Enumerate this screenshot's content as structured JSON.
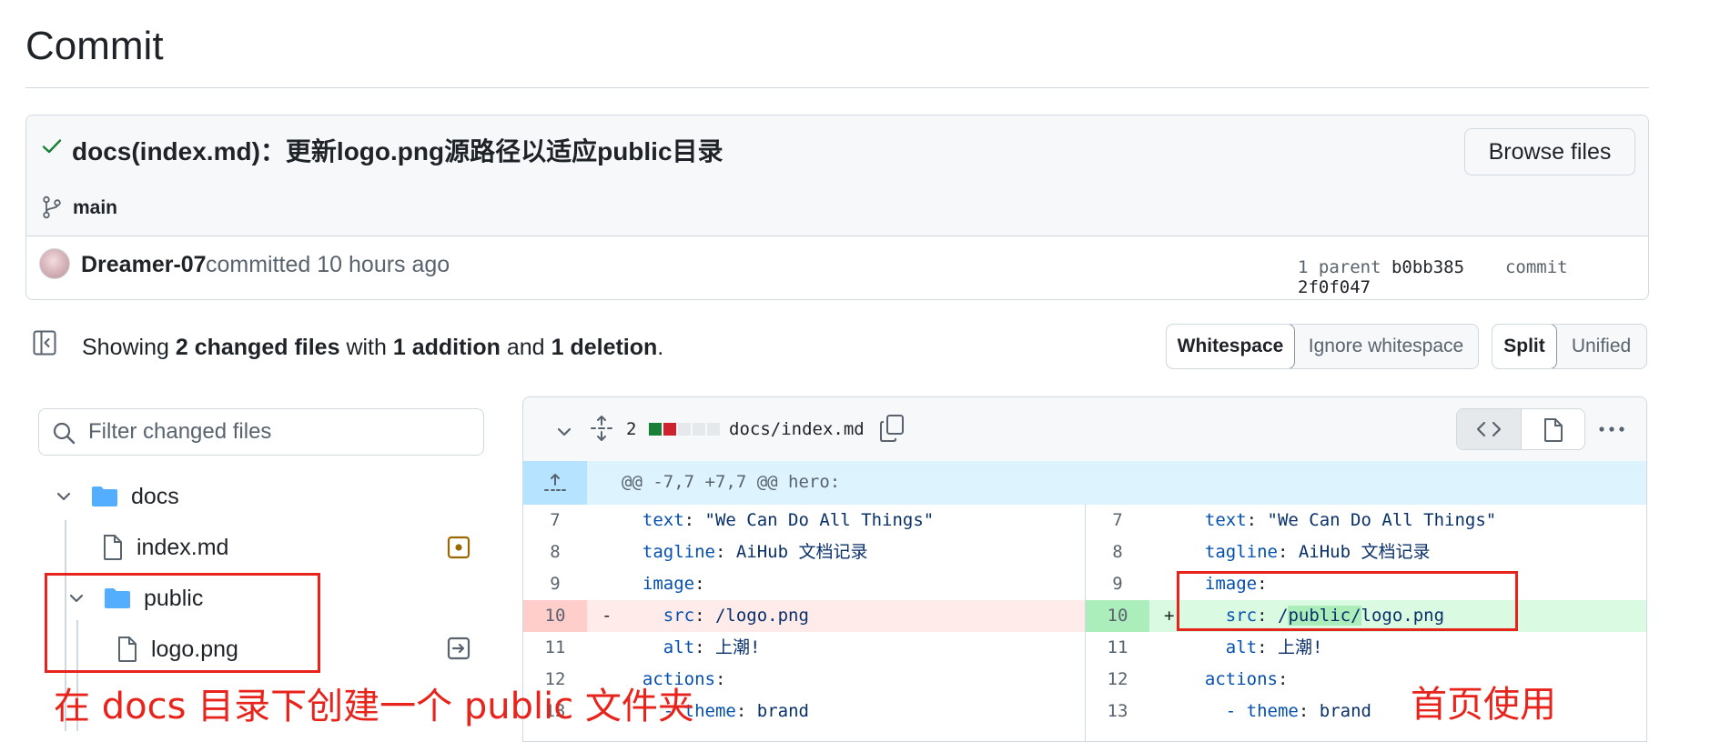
{
  "page": {
    "title": "Commit"
  },
  "commit": {
    "message": "docs(index.md)：更新logo.png源路径以适应public目录",
    "browse_label": "Browse files",
    "branch": "main",
    "author": "Dreamer-07",
    "committed_text": "committed",
    "time_ago": "10 hours ago",
    "parent_label": "1 parent",
    "parent_sha": "b0bb385",
    "commit_label": "commit",
    "commit_sha": "2f0f047"
  },
  "summary": {
    "prefix": "Showing",
    "files": "2 changed files",
    "with": "with",
    "additions": "1 addition",
    "and": "and",
    "deletions": "1 deletion",
    "end": "."
  },
  "view_options": {
    "whitespace": "Whitespace",
    "ignore_whitespace": "Ignore whitespace",
    "split": "Split",
    "unified": "Unified"
  },
  "file_tree": {
    "filter_placeholder": "Filter changed files",
    "items": [
      {
        "name": "docs",
        "type": "folder"
      },
      {
        "name": "index.md",
        "type": "file",
        "status": "modified"
      },
      {
        "name": "public",
        "type": "folder"
      },
      {
        "name": "logo.png",
        "type": "file",
        "status": "renamed"
      }
    ]
  },
  "diff": {
    "change_count": "2",
    "path": "docs/index.md",
    "hunk_header": "@@ -7,7 +7,7 @@ hero:",
    "left": [
      {
        "num": "7",
        "key": "text",
        "value": "\"We Can Do All Things\"",
        "indent": "  "
      },
      {
        "num": "8",
        "key": "tagline",
        "value": "AiHub 文档记录",
        "indent": "  "
      },
      {
        "num": "9",
        "key": "image",
        "value": "",
        "indent": "  "
      },
      {
        "num": "10",
        "key": "src",
        "value": "/logo.png",
        "indent": "    ",
        "marker": "-"
      },
      {
        "num": "11",
        "key": "alt",
        "value": "上潮!",
        "indent": "    "
      },
      {
        "num": "12",
        "key": "actions",
        "value": "",
        "indent": "  "
      },
      {
        "num": "13",
        "key": "theme",
        "value": "brand",
        "indent": "    - "
      }
    ],
    "right": [
      {
        "num": "7",
        "key": "text",
        "value": "\"We Can Do All Things\"",
        "indent": "  "
      },
      {
        "num": "8",
        "key": "tagline",
        "value": "AiHub 文档记录",
        "indent": "  "
      },
      {
        "num": "9",
        "key": "image",
        "value": "",
        "indent": "  "
      },
      {
        "num": "10",
        "key": "src",
        "value_pre": "/",
        "value_hl": "public/",
        "value_post": "logo.png",
        "indent": "    ",
        "marker": "+"
      },
      {
        "num": "11",
        "key": "alt",
        "value": "上潮!",
        "indent": "    "
      },
      {
        "num": "12",
        "key": "actions",
        "value": "",
        "indent": "  "
      },
      {
        "num": "13",
        "key": "theme",
        "value": "brand",
        "indent": "    - "
      }
    ]
  },
  "annotations": {
    "left_note": "在 docs 目录下创建一个 public 文件夹",
    "right_note": "首页使用"
  },
  "colors": {
    "annotation_red": "#e8231b",
    "addition_bg": "#dafbe1",
    "deletion_bg": "#ffebe9",
    "folder_blue": "#54aeff",
    "check_green": "#1a7f37"
  }
}
